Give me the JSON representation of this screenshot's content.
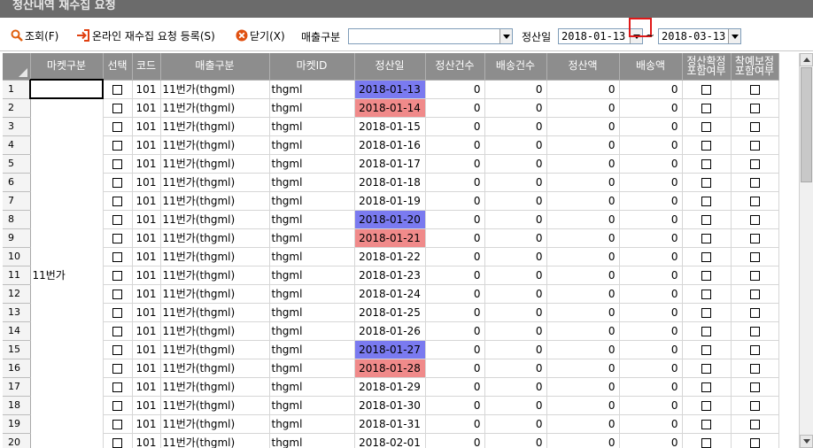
{
  "window": {
    "title": "정산내역 재수집 요청"
  },
  "toolbar": {
    "search_label": "조회(F)",
    "register_label": "온라인 재수집 요청 등록(S)",
    "close_label": "닫기(X)",
    "sales_type_label": "매출구분",
    "sales_type_value": "",
    "settle_date_label": "정산일",
    "date_from": "2018-01-13",
    "tilde": "~",
    "date_to": "2018-03-13"
  },
  "grid": {
    "headers": {
      "market_type": "마켓구분",
      "select": "선택",
      "code": "코드",
      "sales_type": "매출구분",
      "market_id": "마켓ID",
      "settle_date": "정산일",
      "settle_count": "정산건수",
      "ship_count": "배송건수",
      "settle_amount": "정산액",
      "ship_amount": "배송액",
      "settle_incl_1": "정산확정",
      "settle_incl_2": "포함여부",
      "delivery_incl_1": "착예보정",
      "delivery_incl_2": "포함여부"
    },
    "market_type_value": "11번가",
    "rows": [
      {
        "n": "1",
        "code": "101",
        "sales": "11번가(thgml)",
        "id": "thgml",
        "date": "2018-01-13",
        "hl": "blue",
        "c1": "0",
        "c2": "0",
        "c3": "0",
        "c4": "0"
      },
      {
        "n": "2",
        "code": "101",
        "sales": "11번가(thgml)",
        "id": "thgml",
        "date": "2018-01-14",
        "hl": "red",
        "c1": "0",
        "c2": "0",
        "c3": "0",
        "c4": "0"
      },
      {
        "n": "3",
        "code": "101",
        "sales": "11번가(thgml)",
        "id": "thgml",
        "date": "2018-01-15",
        "hl": "",
        "c1": "0",
        "c2": "0",
        "c3": "0",
        "c4": "0"
      },
      {
        "n": "4",
        "code": "101",
        "sales": "11번가(thgml)",
        "id": "thgml",
        "date": "2018-01-16",
        "hl": "",
        "c1": "0",
        "c2": "0",
        "c3": "0",
        "c4": "0"
      },
      {
        "n": "5",
        "code": "101",
        "sales": "11번가(thgml)",
        "id": "thgml",
        "date": "2018-01-17",
        "hl": "",
        "c1": "0",
        "c2": "0",
        "c3": "0",
        "c4": "0"
      },
      {
        "n": "6",
        "code": "101",
        "sales": "11번가(thgml)",
        "id": "thgml",
        "date": "2018-01-18",
        "hl": "",
        "c1": "0",
        "c2": "0",
        "c3": "0",
        "c4": "0"
      },
      {
        "n": "7",
        "code": "101",
        "sales": "11번가(thgml)",
        "id": "thgml",
        "date": "2018-01-19",
        "hl": "",
        "c1": "0",
        "c2": "0",
        "c3": "0",
        "c4": "0"
      },
      {
        "n": "8",
        "code": "101",
        "sales": "11번가(thgml)",
        "id": "thgml",
        "date": "2018-01-20",
        "hl": "blue",
        "c1": "0",
        "c2": "0",
        "c3": "0",
        "c4": "0"
      },
      {
        "n": "9",
        "code": "101",
        "sales": "11번가(thgml)",
        "id": "thgml",
        "date": "2018-01-21",
        "hl": "red",
        "c1": "0",
        "c2": "0",
        "c3": "0",
        "c4": "0"
      },
      {
        "n": "10",
        "code": "101",
        "sales": "11번가(thgml)",
        "id": "thgml",
        "date": "2018-01-22",
        "hl": "",
        "c1": "0",
        "c2": "0",
        "c3": "0",
        "c4": "0"
      },
      {
        "n": "11",
        "code": "101",
        "sales": "11번가(thgml)",
        "id": "thgml",
        "date": "2018-01-23",
        "hl": "",
        "c1": "0",
        "c2": "0",
        "c3": "0",
        "c4": "0"
      },
      {
        "n": "12",
        "code": "101",
        "sales": "11번가(thgml)",
        "id": "thgml",
        "date": "2018-01-24",
        "hl": "",
        "c1": "0",
        "c2": "0",
        "c3": "0",
        "c4": "0"
      },
      {
        "n": "13",
        "code": "101",
        "sales": "11번가(thgml)",
        "id": "thgml",
        "date": "2018-01-25",
        "hl": "",
        "c1": "0",
        "c2": "0",
        "c3": "0",
        "c4": "0"
      },
      {
        "n": "14",
        "code": "101",
        "sales": "11번가(thgml)",
        "id": "thgml",
        "date": "2018-01-26",
        "hl": "",
        "c1": "0",
        "c2": "0",
        "c3": "0",
        "c4": "0"
      },
      {
        "n": "15",
        "code": "101",
        "sales": "11번가(thgml)",
        "id": "thgml",
        "date": "2018-01-27",
        "hl": "blue",
        "c1": "0",
        "c2": "0",
        "c3": "0",
        "c4": "0"
      },
      {
        "n": "16",
        "code": "101",
        "sales": "11번가(thgml)",
        "id": "thgml",
        "date": "2018-01-28",
        "hl": "red",
        "c1": "0",
        "c2": "0",
        "c3": "0",
        "c4": "0"
      },
      {
        "n": "17",
        "code": "101",
        "sales": "11번가(thgml)",
        "id": "thgml",
        "date": "2018-01-29",
        "hl": "",
        "c1": "0",
        "c2": "0",
        "c3": "0",
        "c4": "0"
      },
      {
        "n": "18",
        "code": "101",
        "sales": "11번가(thgml)",
        "id": "thgml",
        "date": "2018-01-30",
        "hl": "",
        "c1": "0",
        "c2": "0",
        "c3": "0",
        "c4": "0"
      },
      {
        "n": "19",
        "code": "101",
        "sales": "11번가(thgml)",
        "id": "thgml",
        "date": "2018-01-31",
        "hl": "",
        "c1": "0",
        "c2": "0",
        "c3": "0",
        "c4": "0"
      },
      {
        "n": "20",
        "code": "101",
        "sales": "11번가(thgml)",
        "id": "thgml",
        "date": "2018-02-01",
        "hl": "",
        "c1": "0",
        "c2": "0",
        "c3": "0",
        "c4": "0"
      }
    ]
  },
  "colors": {
    "header_bg": "#8d8d8d",
    "weekend_blue": "#7a7af0",
    "weekend_red": "#f08a8a",
    "highlight_box": "#e01818"
  },
  "icons": {
    "search": "magnifier-icon",
    "register": "enter-arrow-icon",
    "close": "close-circle-icon"
  }
}
